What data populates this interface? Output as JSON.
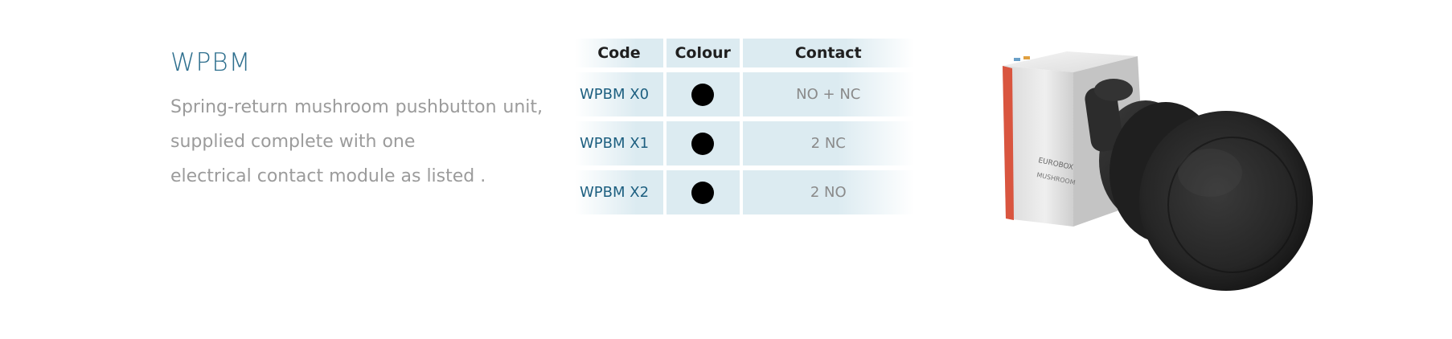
{
  "title": "WPBM",
  "description": {
    "line1": "Spring-return  mushroom  pushbutton  unit,",
    "line2": "supplied complete with one",
    "line3": "electrical contact module as listed ."
  },
  "table": {
    "headers": {
      "code": "Code",
      "colour": "Colour",
      "contact": "Contact"
    },
    "rows": [
      {
        "code": "WPBM X0",
        "colour": "black",
        "contact": "NO + NC"
      },
      {
        "code": "WPBM X1",
        "colour": "black",
        "contact": "2 NC"
      },
      {
        "code": "WPBM X2",
        "colour": "black",
        "contact": "2 NO"
      }
    ]
  },
  "product_image": {
    "label_line1": "EUROBOX",
    "label_line2": "MUSHROOM"
  },
  "colors": {
    "title": "#2e6f8e",
    "code_text": "#1d5f80",
    "table_fill": "#dcebf1",
    "body_text": "#9b9b9b"
  }
}
